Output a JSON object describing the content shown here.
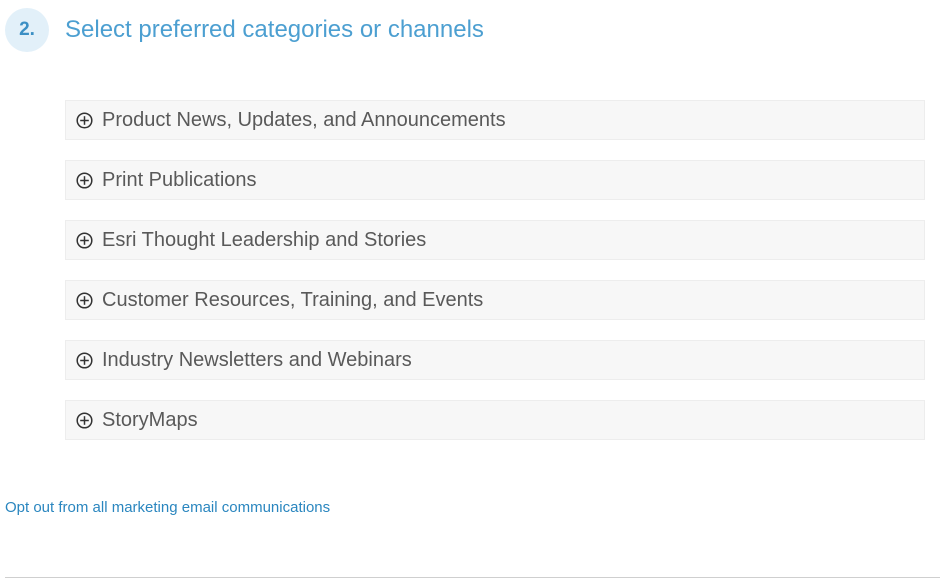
{
  "step": {
    "number": "2.",
    "title": "Select preferred categories or channels"
  },
  "categories": [
    {
      "label": "Product News, Updates, and Announcements",
      "icon": "plus-circle-icon"
    },
    {
      "label": "Print Publications",
      "icon": "plus-circle-icon"
    },
    {
      "label": "Esri Thought Leadership and Stories",
      "icon": "plus-circle-icon"
    },
    {
      "label": "Customer Resources, Training, and Events",
      "icon": "plus-circle-icon"
    },
    {
      "label": "Industry Newsletters and Webinars",
      "icon": "plus-circle-icon"
    },
    {
      "label": "StoryMaps",
      "icon": "plus-circle-icon"
    }
  ],
  "opt_out": {
    "label": "Opt out from all marketing email communications"
  },
  "colors": {
    "accent": "#4c9fd1",
    "badge_bg": "#e2f0f9",
    "item_bg": "#f7f7f7",
    "item_text": "#595959",
    "link": "#2a86bf"
  }
}
